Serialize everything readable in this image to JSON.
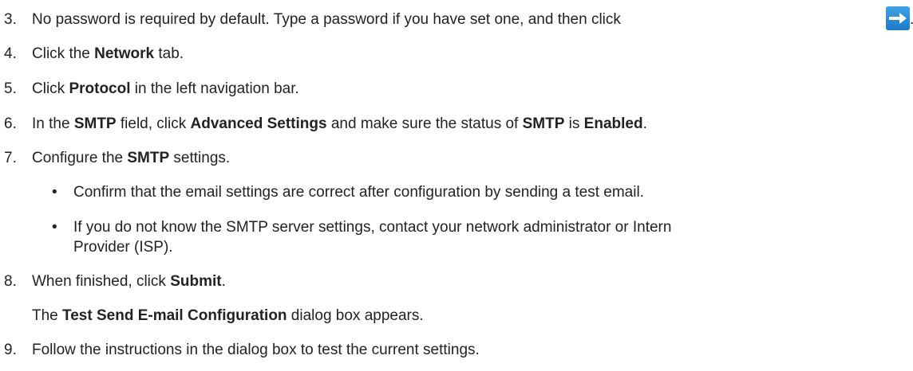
{
  "steps": [
    {
      "num": "3.",
      "parts": [
        {
          "t": "No password is required by default. Type a password if you have set one, and then click ",
          "b": false
        }
      ],
      "after_icon": "."
    },
    {
      "num": "4.",
      "parts": [
        {
          "t": "Click the ",
          "b": false
        },
        {
          "t": "Network",
          "b": true
        },
        {
          "t": " tab.",
          "b": false
        }
      ]
    },
    {
      "num": "5.",
      "parts": [
        {
          "t": "Click ",
          "b": false
        },
        {
          "t": "Protocol",
          "b": true
        },
        {
          "t": " in the left navigation bar.",
          "b": false
        }
      ]
    },
    {
      "num": "6.",
      "parts": [
        {
          "t": "In the ",
          "b": false
        },
        {
          "t": "SMTP",
          "b": true
        },
        {
          "t": " field, click ",
          "b": false
        },
        {
          "t": "Advanced Settings",
          "b": true
        },
        {
          "t": " and make sure the status of ",
          "b": false
        },
        {
          "t": "SMTP",
          "b": true
        },
        {
          "t": " is ",
          "b": false
        },
        {
          "t": "Enabled",
          "b": true
        },
        {
          "t": ".",
          "b": false
        }
      ]
    },
    {
      "num": "7.",
      "parts": [
        {
          "t": "Configure the ",
          "b": false
        },
        {
          "t": "SMTP",
          "b": true
        },
        {
          "t": " settings.",
          "b": false
        }
      ]
    },
    {
      "num": "8.",
      "parts": [
        {
          "t": "When finished, click ",
          "b": false
        },
        {
          "t": "Submit",
          "b": true
        },
        {
          "t": ".",
          "b": false
        }
      ]
    },
    {
      "num": "9.",
      "parts": [
        {
          "t": "Follow the instructions in the dialog box to test the current settings.",
          "b": false
        }
      ]
    }
  ],
  "bullets": [
    {
      "text": "Confirm that the email settings are correct after configuration by sending a test email."
    },
    {
      "text": "If you do not know the SMTP server settings, contact your network administrator or Intern",
      "cont": "Provider (ISP)."
    }
  ],
  "bullet_char": "•",
  "step8_result": [
    {
      "t": "The ",
      "b": false
    },
    {
      "t": "Test Send E-mail Configuration",
      "b": true
    },
    {
      "t": " dialog box appears.",
      "b": false
    }
  ],
  "icon": {
    "name": "arrow-right-icon",
    "color_top": "#3fa3e6",
    "color_bottom": "#1e78c8"
  }
}
